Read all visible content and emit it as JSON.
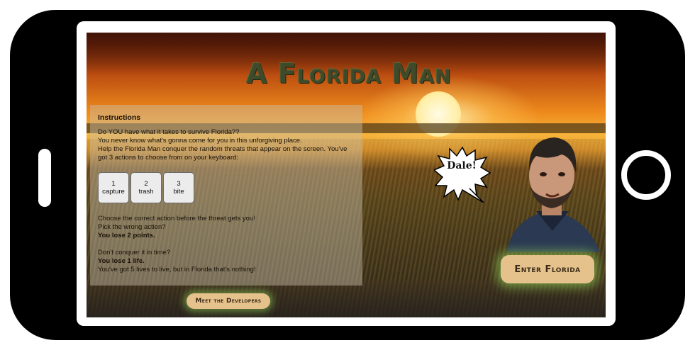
{
  "game": {
    "title": "A Florida Man"
  },
  "instructions": {
    "heading": "Instructions",
    "intro_lines": [
      "Do YOU have what it takes to survive Florida??",
      "You never know what's gonna come for you in this unforgiving place.",
      "Help the Florida Man conquer the random threats that appear on the screen. You've got 3 actions to choose from on your keyboard:"
    ],
    "keys": [
      {
        "number": "1",
        "label": "capture"
      },
      {
        "number": "2",
        "label": "trash"
      },
      {
        "number": "3",
        "label": "bite"
      }
    ],
    "wrong_lines": [
      "Choose the correct action before the threat gets you!",
      "Pick the wrong action?"
    ],
    "wrong_penalty": "You lose 2 points.",
    "time_line": "Don't conquer it in time?",
    "time_penalty": "You lose 1 life.",
    "lives_line": "You've got 5 lives to live, but in Florida that's nothing!"
  },
  "character": {
    "speech": "Dale!"
  },
  "buttons": {
    "enter": "Enter Florida",
    "developers": "Meet the Developers"
  },
  "colors": {
    "title": "#3f4a2a",
    "button_bg": "#e5c28c",
    "button_glow": "#96dc5a",
    "panel": "#c8beaa"
  }
}
